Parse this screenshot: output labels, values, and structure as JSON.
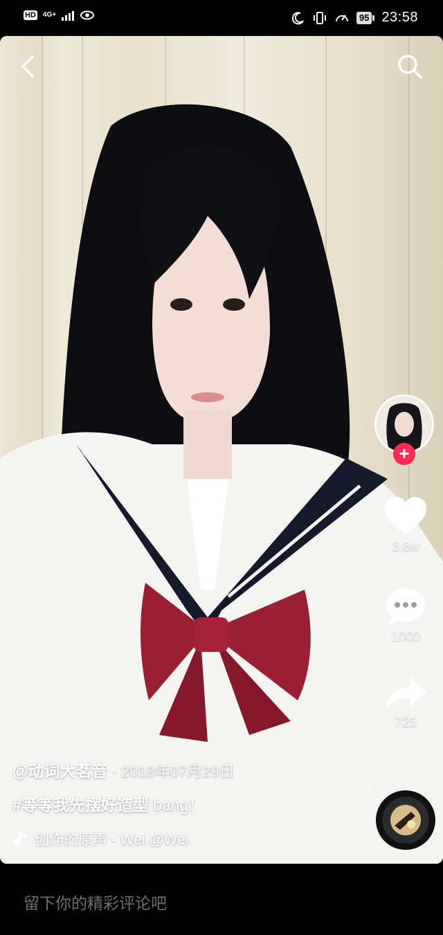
{
  "status_bar": {
    "hd": "HD",
    "network": "4G+",
    "battery": "95",
    "time": "23:58"
  },
  "video": {
    "author": "@动词大茗音",
    "date_separator": "·",
    "date": "2018年07月29日",
    "hashtag": "#等等我先摆好造型",
    "caption_tail": " bang！",
    "music": "创作的原声 - Wei     @Wei",
    "colors": {
      "like": "#ffffff",
      "follow": "#fe2c55"
    }
  },
  "actions": {
    "likes": "3.6w",
    "comments": "1000",
    "shares": "725"
  },
  "comment_bar": {
    "placeholder": "留下你的精彩评论吧"
  }
}
